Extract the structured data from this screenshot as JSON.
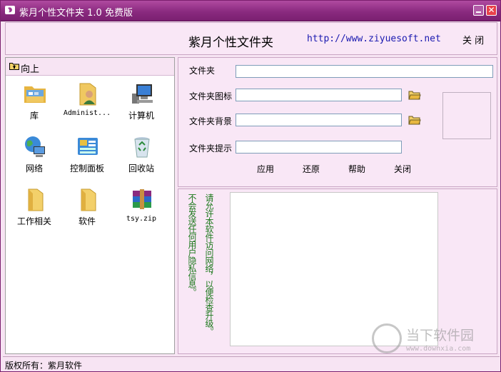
{
  "titlebar": {
    "title": "紫月个性文件夹 1.0 免费版",
    "close_glyph": "✕"
  },
  "header": {
    "title": "紫月个性文件夹",
    "link": "http://www.ziyuesoft.net",
    "close_label": "关 闭"
  },
  "left": {
    "up_label": "向上",
    "items": [
      {
        "label": "库",
        "icon": "library-icon"
      },
      {
        "label": "Administ...",
        "icon": "user-folder-icon"
      },
      {
        "label": "计算机",
        "icon": "computer-icon"
      },
      {
        "label": "网络",
        "icon": "network-icon"
      },
      {
        "label": "控制面板",
        "icon": "control-panel-icon"
      },
      {
        "label": "回收站",
        "icon": "recycle-bin-icon"
      },
      {
        "label": "工作相关",
        "icon": "folder-icon"
      },
      {
        "label": "软件",
        "icon": "folder-icon"
      },
      {
        "label": "tsy.zip",
        "icon": "winrar-archive-icon"
      }
    ]
  },
  "form": {
    "folder_label": "文件夹",
    "folder_value": "",
    "icon_label": "文件夹图标",
    "icon_value": "",
    "bg_label": "文件夹背景",
    "bg_value": "",
    "tip_label": "文件夹提示",
    "tip_value": "",
    "buttons": {
      "apply": "应用",
      "restore": "还原",
      "help": "帮助",
      "close": "关闭"
    }
  },
  "notice": {
    "line1": "请允许本软件访问网络，以便检查升级。",
    "line2": "不会发送任何用户隐私信息。"
  },
  "status": {
    "text": "版权所有：紫月软件"
  },
  "watermark": {
    "text": "当下软件园",
    "url": "www.downxia.com"
  },
  "colors": {
    "accent": "#8a2a7f",
    "panel": "#f9e7f6",
    "notice_text": "#1f7a1f",
    "link": "#1a1ab0"
  }
}
